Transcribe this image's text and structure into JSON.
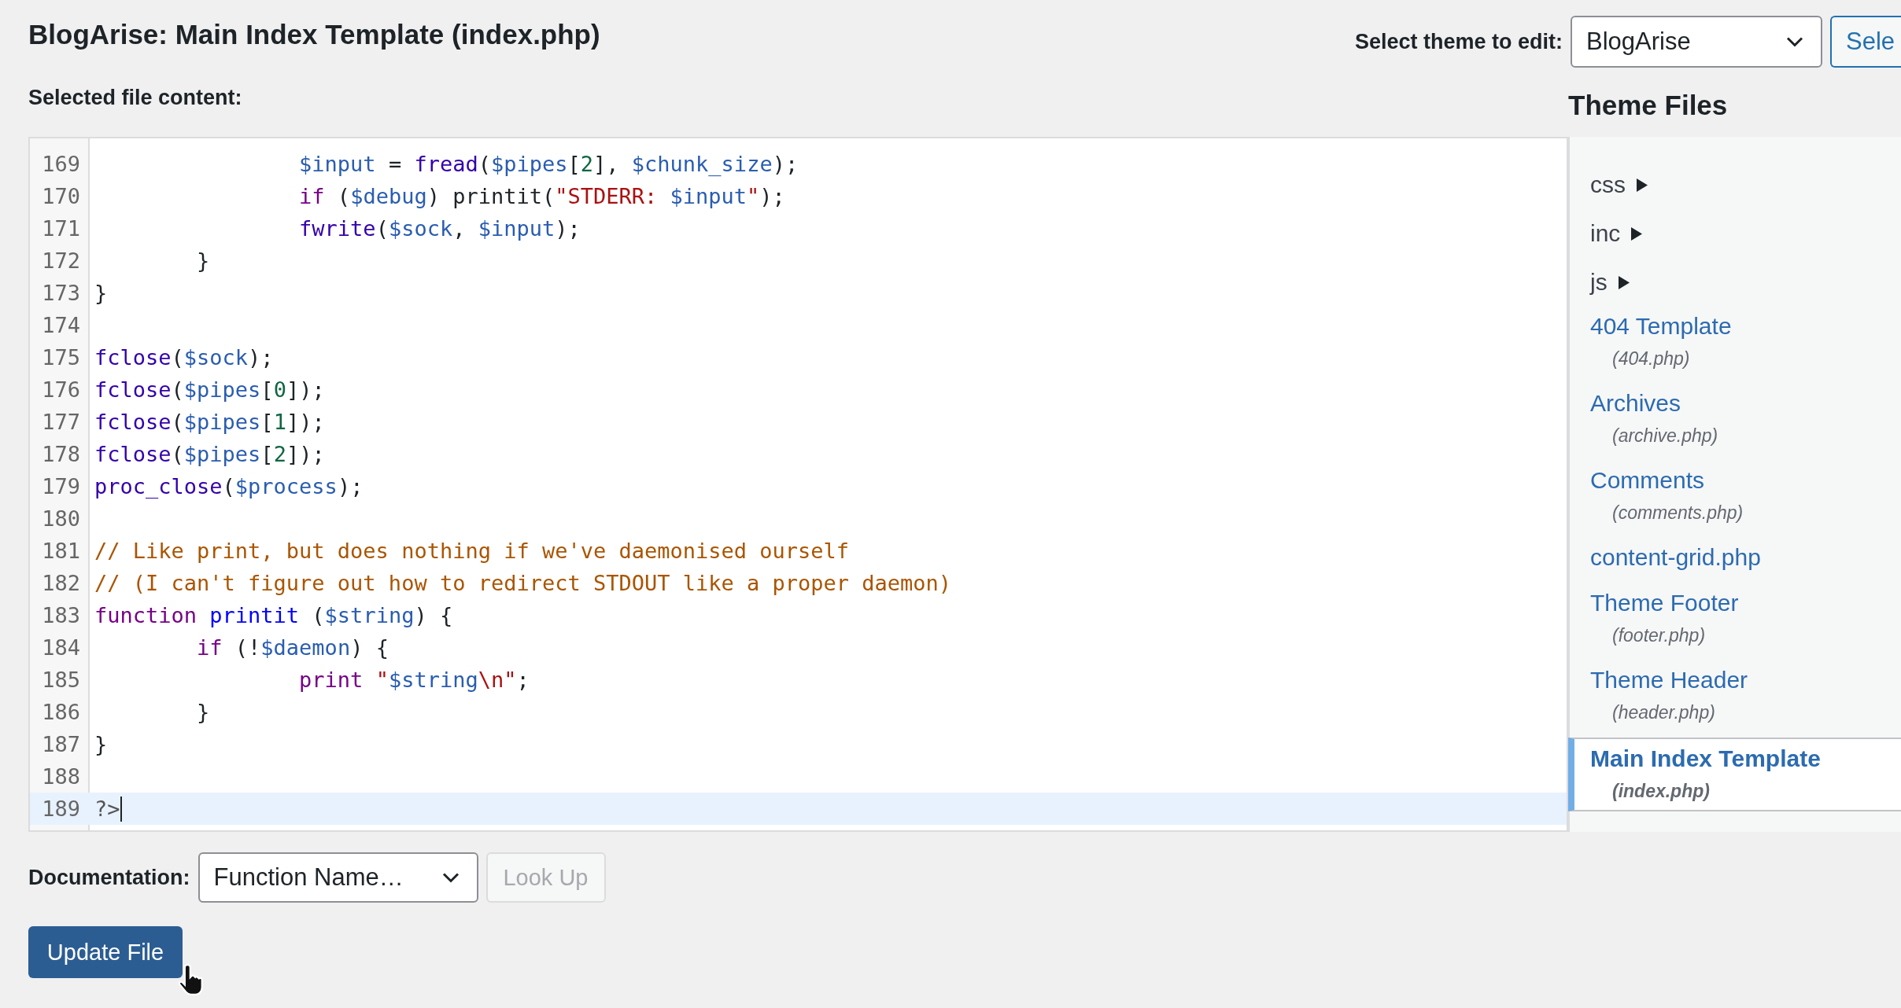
{
  "page_title": "BlogArise: Main Index Template (index.php)",
  "theme_select": {
    "label": "Select theme to edit:",
    "value": "BlogArise",
    "button": "Sele"
  },
  "editor": {
    "label": "Selected file content:",
    "lines": [
      {
        "number": "169",
        "active": false,
        "tokens": [
          {
            "text": "\t\t$input",
            "kind": "variable"
          },
          {
            "text": " = ",
            "kind": "plain"
          },
          {
            "text": "fread",
            "kind": "builtin"
          },
          {
            "text": "(",
            "kind": "plain"
          },
          {
            "text": "$pipes",
            "kind": "variable"
          },
          {
            "text": "[",
            "kind": "plain"
          },
          {
            "text": "2",
            "kind": "number"
          },
          {
            "text": "], ",
            "kind": "plain"
          },
          {
            "text": "$chunk_size",
            "kind": "variable"
          },
          {
            "text": ");",
            "kind": "plain"
          }
        ]
      },
      {
        "number": "170",
        "active": false,
        "tokens": [
          {
            "text": "\t\tif",
            "kind": "keyword"
          },
          {
            "text": " (",
            "kind": "plain"
          },
          {
            "text": "$debug",
            "kind": "variable"
          },
          {
            "text": ") printit(",
            "kind": "plain"
          },
          {
            "text": "\"STDERR: ",
            "kind": "string"
          },
          {
            "text": "$input",
            "kind": "variable"
          },
          {
            "text": "\"",
            "kind": "string"
          },
          {
            "text": ");",
            "kind": "plain"
          }
        ]
      },
      {
        "number": "171",
        "active": false,
        "tokens": [
          {
            "text": "\t\tfwrite",
            "kind": "builtin"
          },
          {
            "text": "(",
            "kind": "plain"
          },
          {
            "text": "$sock",
            "kind": "variable"
          },
          {
            "text": ", ",
            "kind": "plain"
          },
          {
            "text": "$input",
            "kind": "variable"
          },
          {
            "text": ");",
            "kind": "plain"
          }
        ]
      },
      {
        "number": "172",
        "active": false,
        "tokens": [
          {
            "text": "\t}",
            "kind": "plain"
          }
        ]
      },
      {
        "number": "173",
        "active": false,
        "tokens": [
          {
            "text": "}",
            "kind": "plain"
          }
        ]
      },
      {
        "number": "174",
        "active": false
      },
      {
        "number": "175",
        "active": false,
        "tokens": [
          {
            "text": "fclose",
            "kind": "builtin"
          },
          {
            "text": "(",
            "kind": "plain"
          },
          {
            "text": "$sock",
            "kind": "variable"
          },
          {
            "text": ");",
            "kind": "plain"
          }
        ]
      },
      {
        "number": "176",
        "active": false,
        "tokens": [
          {
            "text": "fclose",
            "kind": "builtin"
          },
          {
            "text": "(",
            "kind": "plain"
          },
          {
            "text": "$pipes",
            "kind": "variable"
          },
          {
            "text": "[",
            "kind": "plain"
          },
          {
            "text": "0",
            "kind": "number"
          },
          {
            "text": "]);",
            "kind": "plain"
          }
        ]
      },
      {
        "number": "177",
        "active": false,
        "tokens": [
          {
            "text": "fclose",
            "kind": "builtin"
          },
          {
            "text": "(",
            "kind": "plain"
          },
          {
            "text": "$pipes",
            "kind": "variable"
          },
          {
            "text": "[",
            "kind": "plain"
          },
          {
            "text": "1",
            "kind": "number"
          },
          {
            "text": "]);",
            "kind": "plain"
          }
        ]
      },
      {
        "number": "178",
        "active": false,
        "tokens": [
          {
            "text": "fclose",
            "kind": "builtin"
          },
          {
            "text": "(",
            "kind": "plain"
          },
          {
            "text": "$pipes",
            "kind": "variable"
          },
          {
            "text": "[",
            "kind": "plain"
          },
          {
            "text": "2",
            "kind": "number"
          },
          {
            "text": "]);",
            "kind": "plain"
          }
        ]
      },
      {
        "number": "179",
        "active": false,
        "tokens": [
          {
            "text": "proc_close",
            "kind": "builtin"
          },
          {
            "text": "(",
            "kind": "plain"
          },
          {
            "text": "$process",
            "kind": "variable"
          },
          {
            "text": ");",
            "kind": "plain"
          }
        ]
      },
      {
        "number": "180",
        "active": false
      },
      {
        "number": "181",
        "active": false,
        "tokens": [
          {
            "text": "// Like print, but does nothing if we've daemonised ourself",
            "kind": "comment"
          }
        ]
      },
      {
        "number": "182",
        "active": false,
        "tokens": [
          {
            "text": "// (I can't figure out how to redirect STDOUT like a proper daemon)",
            "kind": "comment"
          }
        ]
      },
      {
        "number": "183",
        "active": false,
        "tokens": [
          {
            "text": "function",
            "kind": "keyword"
          },
          {
            "text": " printit",
            "kind": "def"
          },
          {
            "text": " (",
            "kind": "plain"
          },
          {
            "text": "$string",
            "kind": "variable"
          },
          {
            "text": ") {",
            "kind": "plain"
          }
        ]
      },
      {
        "number": "184",
        "active": false,
        "tokens": [
          {
            "text": "\tif",
            "kind": "keyword"
          },
          {
            "text": " (!",
            "kind": "plain"
          },
          {
            "text": "$daemon",
            "kind": "variable"
          },
          {
            "text": ") {",
            "kind": "plain"
          }
        ]
      },
      {
        "number": "185",
        "active": false,
        "tokens": [
          {
            "text": "\t\tprint",
            "kind": "keyword"
          },
          {
            "text": " \"",
            "kind": "string"
          },
          {
            "text": "$string",
            "kind": "variable"
          },
          {
            "text": "\\n\"",
            "kind": "string"
          },
          {
            "text": ";",
            "kind": "plain"
          }
        ]
      },
      {
        "number": "186",
        "active": false,
        "tokens": [
          {
            "text": "\t}",
            "kind": "plain"
          }
        ]
      },
      {
        "number": "187",
        "active": false,
        "tokens": [
          {
            "text": "}",
            "kind": "plain"
          }
        ]
      },
      {
        "number": "188",
        "active": false
      },
      {
        "number": "189",
        "active": true,
        "tokens": [
          {
            "text": "?>",
            "kind": "meta"
          }
        ]
      }
    ]
  },
  "theme_files": {
    "title": "Theme Files",
    "items": [
      {
        "kind": "folder",
        "label": "css"
      },
      {
        "kind": "folder",
        "label": "inc"
      },
      {
        "kind": "folder",
        "label": "js"
      },
      {
        "kind": "file",
        "label": "404 Template",
        "filename": "(404.php)",
        "selected": false
      },
      {
        "kind": "file",
        "label": "Archives",
        "filename": "(archive.php)",
        "selected": false
      },
      {
        "kind": "file",
        "label": "Comments",
        "filename": "(comments.php)",
        "selected": false
      },
      {
        "kind": "file",
        "label": "content-grid.php",
        "selected": false
      },
      {
        "kind": "file",
        "label": "Theme Footer",
        "filename": "(footer.php)",
        "selected": false
      },
      {
        "kind": "file",
        "label": "Theme Header",
        "filename": "(header.php)",
        "selected": false
      },
      {
        "kind": "file",
        "label": "Main Index Template",
        "filename": "(index.php)",
        "selected": true
      }
    ]
  },
  "documentation": {
    "label": "Documentation:",
    "value": "Function Name…",
    "button": "Look Up",
    "button_disabled": true
  },
  "update_button": "Update File"
}
